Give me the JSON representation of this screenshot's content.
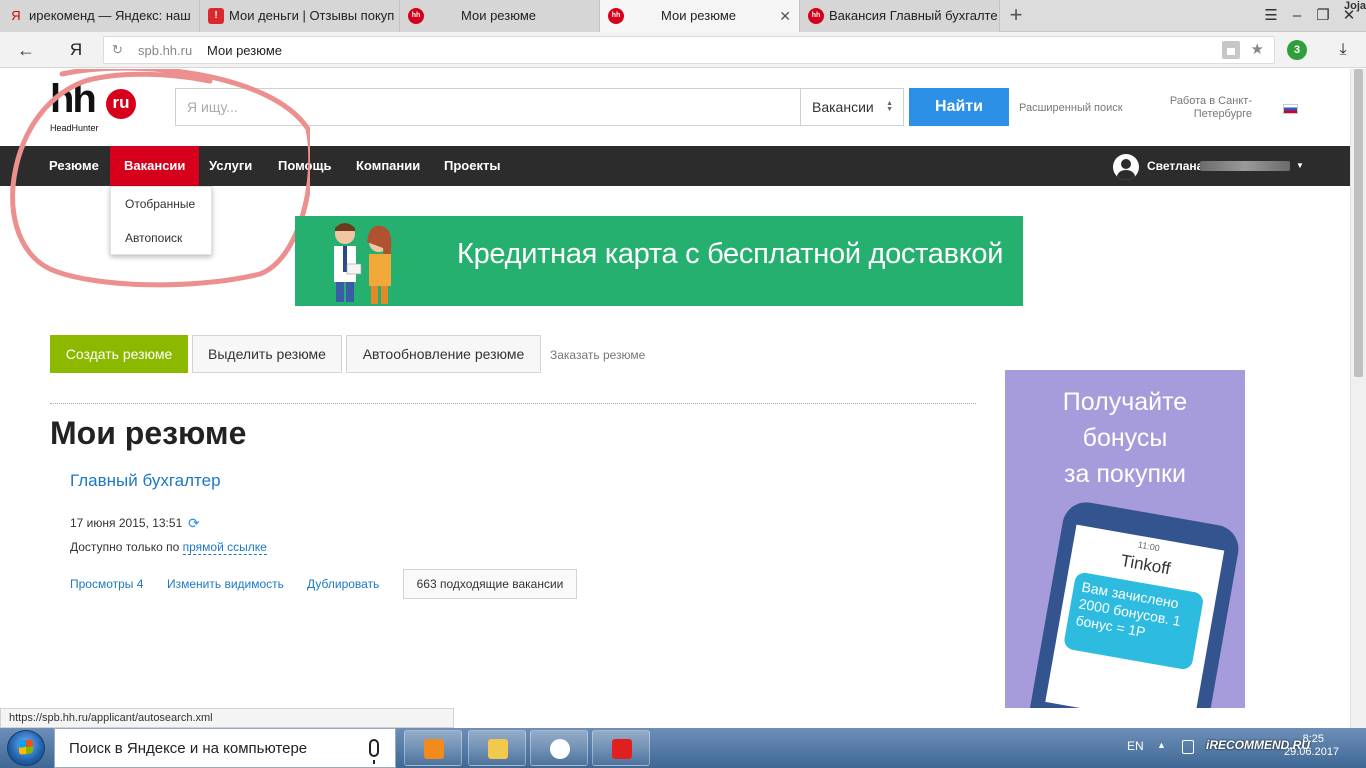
{
  "browser": {
    "tabs": [
      {
        "label": "ирекоменд — Яндекс: наш",
        "favicon": "yandex-icon"
      },
      {
        "label": "Мои деньги | Отзывы покуп",
        "favicon": "irecommend-icon"
      },
      {
        "label": "Мои резюме",
        "favicon": "hh-icon"
      },
      {
        "label": "Мои резюме",
        "favicon": "hh-icon",
        "active": true
      },
      {
        "label": "Вакансия Главный бухгалте",
        "favicon": "hh-icon"
      }
    ],
    "new_tab": "+",
    "corner_label": "Joja",
    "extension_badge": "3",
    "address": {
      "domain": "spb.hh.ru",
      "page_title": "Мои резюме"
    },
    "status_url": "https://spb.hh.ru/applicant/autosearch.xml",
    "favicon_hh_text": "hh",
    "ya_button": "Я"
  },
  "site": {
    "logo": {
      "text": "hh",
      "badge": "ru",
      "subtitle": "HeadHunter"
    },
    "search": {
      "placeholder": "Я ищу...",
      "category": "Вакансии",
      "submit": "Найти"
    },
    "advanced_search": "Расширенный поиск",
    "region": "Работа в Санкт-Петербурге",
    "nav": {
      "items": [
        "Резюме",
        "Вакансии",
        "Услуги",
        "Помощь",
        "Компании",
        "Проекты"
      ],
      "active": "Вакансии",
      "user_name": "Светлана Е"
    },
    "dropdown": [
      "Отобранные",
      "Автопоиск"
    ],
    "banner": {
      "text": "Кредитная карта с бесплатной доставкой",
      "bg": "#25b06f"
    },
    "actions": {
      "create": "Создать резюме",
      "highlight": "Выделить резюме",
      "autoupdate": "Автообновление резюме",
      "order": "Заказать резюме"
    },
    "page_title": "Мои резюме",
    "resume": {
      "title": "Главный бухгалтер",
      "updated": "17 июня 2015, 13:51",
      "access_prefix": "Доступно только по",
      "access_link": "прямой ссылке",
      "views": "Просмотры 4",
      "change_visibility": "Изменить видимость",
      "duplicate": "Дублировать",
      "matching": "663 подходящие вакансии"
    },
    "side_ad": {
      "lines": [
        "Получайте",
        "бонусы",
        "за покупки"
      ],
      "phone_time": "11:00",
      "brand": "Tinkoff",
      "message": "Вам зачислено 2000 бонусов. 1 бонус = 1Р",
      "bg": "#a79cdb"
    },
    "colors": {
      "brand_red": "#d6001c",
      "accent_blue": "#2b90e6",
      "create_green": "#8cb800",
      "nav_bg": "#2c2c2c"
    }
  },
  "taskbar": {
    "search_text": "Поиск в Яндексе и на компьютере",
    "apps": [
      "media-player-icon",
      "explorer-icon",
      "yandex-browser-icon",
      "yandex-icon"
    ],
    "lang": "EN",
    "watermark": "iRECOMMEND.RU",
    "time": "8:25",
    "date": "29.06.2017"
  }
}
